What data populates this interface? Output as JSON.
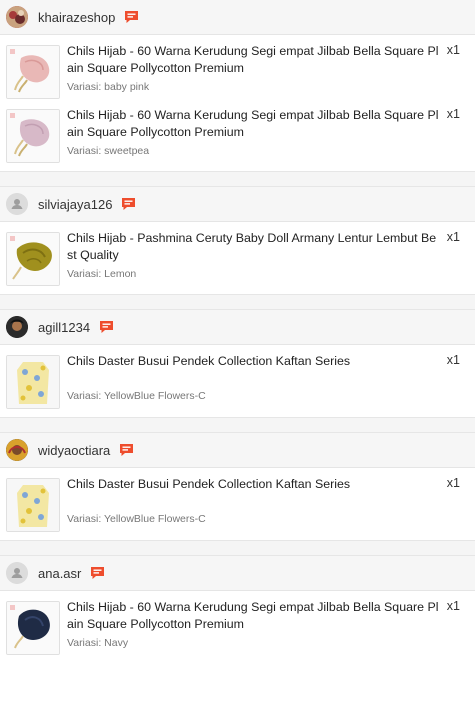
{
  "qty_prefix": "x",
  "colors": {
    "chat_icon": "#ee4d2d",
    "header_bg": "#f6f6f6",
    "gap_bg": "#f5f5f5"
  },
  "orders": [
    {
      "shop": "khairazeshop",
      "avatar_icon": "shop-photo-icon",
      "items": [
        {
          "title": "Chils Hijab - 60 Warna Kerudung Segi empat Jilbab Bella Square Plain Square Pollycotton Premium",
          "variant": "Variasi: baby pink",
          "qty": "x1",
          "thumb": "pink-hijab"
        },
        {
          "title": "Chils Hijab - 60 Warna Kerudung Segi empat Jilbab Bella Square Plain Square Pollycotton Premium",
          "variant": "Variasi: sweetpea",
          "qty": "x1",
          "thumb": "lilac-hijab"
        }
      ]
    },
    {
      "shop": "silviajaya126",
      "avatar_icon": "default-user-icon",
      "items": [
        {
          "title": "Chils Hijab - Pashmina Ceruty Baby Doll Armany Lentur Lembut Best Quality",
          "variant": "Variasi: Lemon",
          "qty": "x1",
          "thumb": "olive-pashmina"
        }
      ]
    },
    {
      "shop": "agill1234",
      "avatar_icon": "user-photo-icon",
      "items": [
        {
          "title": "Chils Daster Busui Pendek Collection Kaftan Series",
          "variant": "Variasi: YellowBlue Flowers-C",
          "qty": "x1",
          "thumb": "floral-dress"
        }
      ]
    },
    {
      "shop": "widyaoctiara",
      "avatar_icon": "user-photo-icon",
      "items": [
        {
          "title": "Chils Daster Busui Pendek Collection Kaftan Series",
          "variant": "Variasi: YellowBlue Flowers-C",
          "qty": "x1",
          "thumb": "floral-dress"
        }
      ]
    },
    {
      "shop": "ana.asr",
      "avatar_icon": "default-user-icon",
      "items": [
        {
          "title": "Chils Hijab - 60 Warna Kerudung Segi empat Jilbab Bella Square Plain Square Pollycotton Premium",
          "variant": "Variasi: Navy",
          "qty": "x1",
          "thumb": "navy-hijab"
        }
      ]
    }
  ]
}
